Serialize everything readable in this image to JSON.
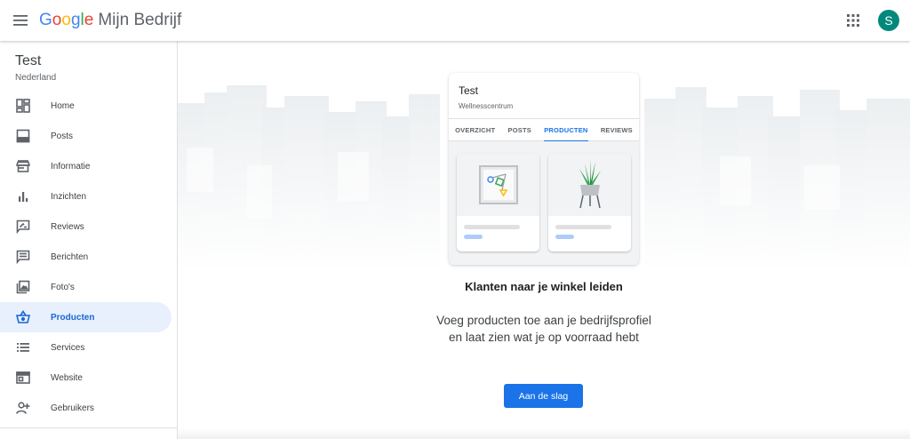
{
  "header": {
    "logo_letters": [
      {
        "char": "G",
        "color": "#4285f4"
      },
      {
        "char": "o",
        "color": "#ea4335"
      },
      {
        "char": "o",
        "color": "#fbbc05"
      },
      {
        "char": "g",
        "color": "#4285f4"
      },
      {
        "char": "l",
        "color": "#34a853"
      },
      {
        "char": "e",
        "color": "#ea4335"
      }
    ],
    "product_name": "Mijn Bedrijf",
    "avatar_initial": "S",
    "avatar_color": "#00897b"
  },
  "sidebar": {
    "business_name": "Test",
    "business_country": "Nederland",
    "items": [
      {
        "label": "Home",
        "icon": "dashboard-icon",
        "active": false
      },
      {
        "label": "Posts",
        "icon": "posts-icon",
        "active": false
      },
      {
        "label": "Informatie",
        "icon": "storefront-icon",
        "active": false
      },
      {
        "label": "Inzichten",
        "icon": "bar-chart-icon",
        "active": false
      },
      {
        "label": "Reviews",
        "icon": "reviews-icon",
        "active": false
      },
      {
        "label": "Berichten",
        "icon": "message-icon",
        "active": false
      },
      {
        "label": "Foto's",
        "icon": "photo-icon",
        "active": false
      },
      {
        "label": "Producten",
        "icon": "basket-icon",
        "active": true
      },
      {
        "label": "Services",
        "icon": "list-icon",
        "active": false
      },
      {
        "label": "Website",
        "icon": "website-icon",
        "active": false
      },
      {
        "label": "Gebruikers",
        "icon": "add-user-icon",
        "active": false
      }
    ]
  },
  "preview_card": {
    "title": "Test",
    "subtitle": "Wellnesscentrum",
    "tabs": [
      {
        "label": "OVERZICHT",
        "active": false
      },
      {
        "label": "POSTS",
        "active": false
      },
      {
        "label": "PRODUCTEN",
        "active": true
      },
      {
        "label": "REVIEWS",
        "active": false
      }
    ]
  },
  "main": {
    "headline": "Klanten naar je winkel leiden",
    "description": "Voeg producten toe aan je bedrijfsprofiel en laat zien wat je op voorraad hebt",
    "cta_label": "Aan de slag"
  },
  "colors": {
    "accent": "#1a73e8",
    "active_bg": "#e8f0fe"
  }
}
